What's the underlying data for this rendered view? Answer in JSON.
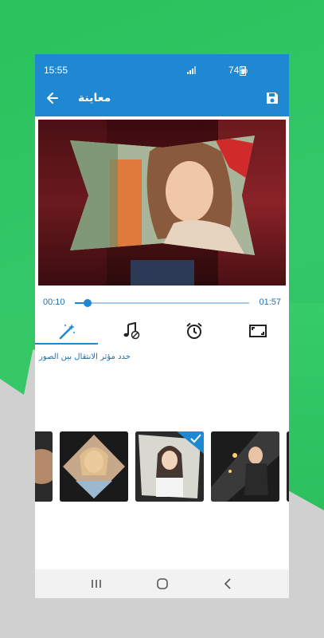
{
  "status_bar": {
    "time": "15:55",
    "battery": "74%"
  },
  "header": {
    "title": "معاينة"
  },
  "player": {
    "current_time": "00:10",
    "total_time": "01:57",
    "progress": 0.075
  },
  "tabs": [
    {
      "icon": "magic-wand-icon",
      "active": true
    },
    {
      "icon": "music-off-icon",
      "active": false
    },
    {
      "icon": "alarm-clock-icon",
      "active": false
    },
    {
      "icon": "aspect-ratio-icon",
      "active": false
    }
  ],
  "hint": {
    "text": "حدد مؤثر الانتقال بين الصور"
  },
  "transitions": [
    {
      "name": "transition-1",
      "selected": false
    },
    {
      "name": "transition-2",
      "selected": false
    },
    {
      "name": "transition-3",
      "selected": true
    },
    {
      "name": "transition-4",
      "selected": false
    },
    {
      "name": "transition-5",
      "selected": false
    }
  ],
  "colors": {
    "accent": "#1e88d2",
    "background": "#2fbd5e"
  }
}
